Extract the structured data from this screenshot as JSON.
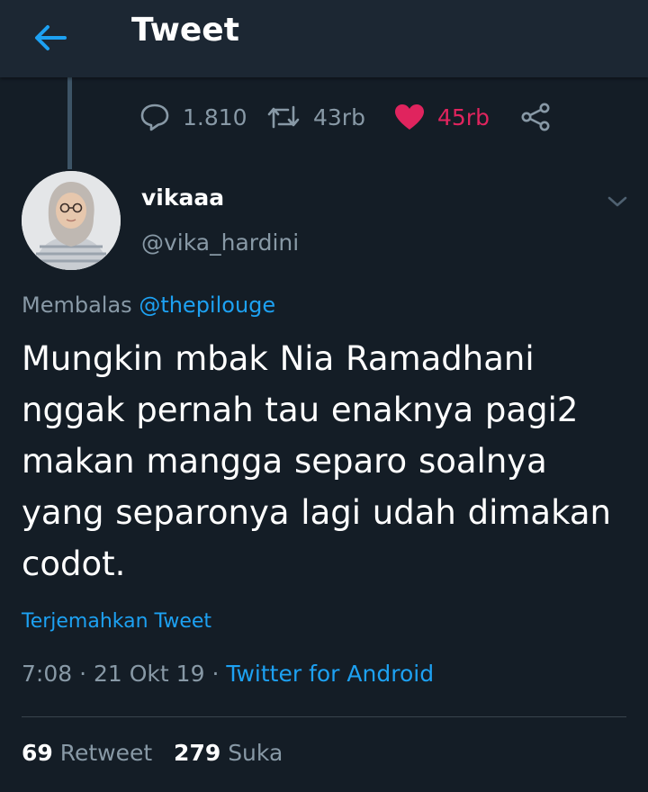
{
  "header": {
    "title": "Tweet"
  },
  "action_bar": {
    "replies": "1.810",
    "retweets": "43rb",
    "likes": "45rb",
    "like_color": "#e0245e"
  },
  "tweet": {
    "display_name": "vikaaa",
    "handle": "@vika_hardini",
    "reply_prefix": "Membalas",
    "reply_to": "@thepilouge",
    "text": "Mungkin mbak Nia Ramadhani nggak pernah tau enaknya pagi2 makan mangga separo soalnya yang separonya lagi udah dimakan codot.",
    "translate_label": "Terjemahkan Tweet",
    "time": "7:08",
    "date": "21 Okt 19",
    "source": "Twitter for Android",
    "separator": "·"
  },
  "stats": {
    "retweet_count": "69",
    "retweet_label": "Retweet",
    "like_count": "279",
    "like_label": "Suka"
  },
  "colors": {
    "background": "#141d26",
    "header": "#1c2733",
    "accent": "#1da1f2",
    "secondary_text": "#8899a6"
  },
  "icons": {
    "back": "arrow-left-icon",
    "reply": "reply-bubble-icon",
    "retweet": "retweet-icon",
    "like": "heart-icon",
    "share": "share-icon",
    "caret": "chevron-down-icon"
  }
}
